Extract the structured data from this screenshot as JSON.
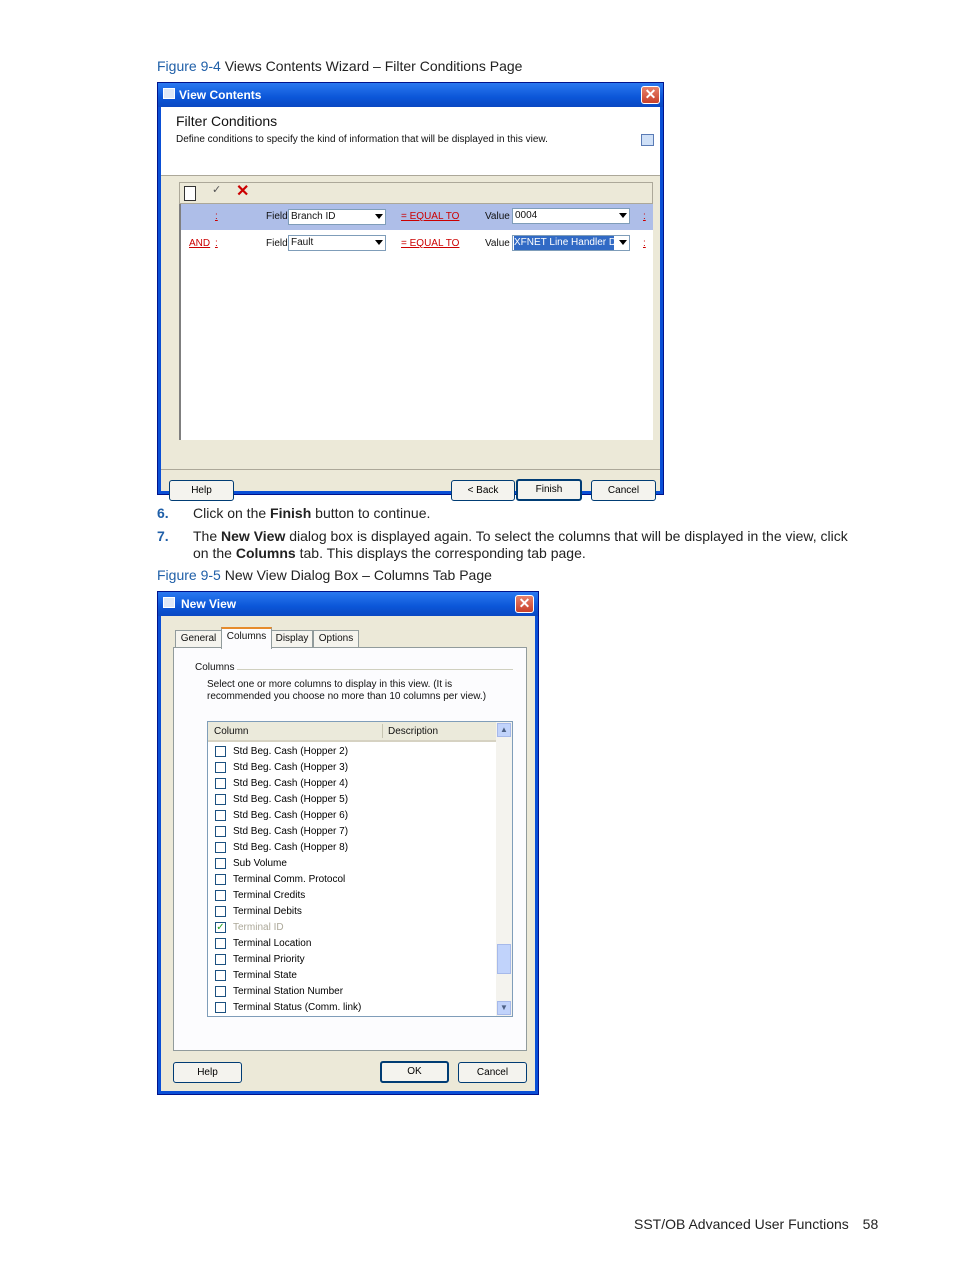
{
  "figure_9_4": {
    "label": "Figure 9-4",
    "caption": "Views Contents Wizard – Filter Conditions Page"
  },
  "view_contents": {
    "title": "View Contents",
    "heading": "Filter Conditions",
    "description": "Define conditions to specify the kind of information that will be displayed in this view.",
    "rows": [
      {
        "conj": "",
        "field_label": "Field",
        "field": "Branch ID",
        "op": "= EQUAL TO",
        "value_label": "Value",
        "value": "0004"
      },
      {
        "conj": "AND",
        "field_label": "Field",
        "field": "Fault",
        "op": "= EQUAL TO",
        "value_label": "Value",
        "value": "XFNET Line Handler Di"
      }
    ],
    "buttons": {
      "help": "Help",
      "back": "< Back",
      "finish": "Finish",
      "cancel": "Cancel"
    }
  },
  "steps": [
    {
      "num": "6.",
      "pre": "Click on the ",
      "b1": "Finish",
      "post": " button to continue."
    },
    {
      "num": "7.",
      "pre": "The ",
      "b1": "New View",
      "mid": " dialog box is displayed again.  To select the columns that will be displayed in the view, click on the ",
      "b2": "Columns",
      "post": " tab.  This displays the corresponding tab page."
    }
  ],
  "figure_9_5": {
    "label": "Figure 9-5",
    "caption": "New View Dialog Box – Columns Tab Page"
  },
  "new_view": {
    "title": "New View",
    "tabs": [
      "General",
      "Columns",
      "Display",
      "Options"
    ],
    "group_label": "Columns",
    "instructions": "Select one or more columns to display in this view. (It is recommended you choose no more than 10 columns per view.)",
    "col_headers": [
      "Column",
      "Description"
    ],
    "items": [
      {
        "label": "Std Beg. Cash  (Hopper 2)",
        "checked": false
      },
      {
        "label": "Std Beg. Cash  (Hopper 3)",
        "checked": false
      },
      {
        "label": "Std Beg. Cash  (Hopper 4)",
        "checked": false
      },
      {
        "label": "Std Beg. Cash  (Hopper 5)",
        "checked": false
      },
      {
        "label": "Std Beg. Cash  (Hopper 6)",
        "checked": false
      },
      {
        "label": "Std Beg. Cash  (Hopper 7)",
        "checked": false
      },
      {
        "label": "Std Beg. Cash  (Hopper 8)",
        "checked": false
      },
      {
        "label": "Sub Volume",
        "checked": false
      },
      {
        "label": "Terminal Comm. Protocol",
        "checked": false
      },
      {
        "label": "Terminal Credits",
        "checked": false
      },
      {
        "label": "Terminal Debits",
        "checked": false
      },
      {
        "label": "Terminal ID",
        "checked": true,
        "disabled": true
      },
      {
        "label": "Terminal Location",
        "checked": false
      },
      {
        "label": "Terminal Priority",
        "checked": false
      },
      {
        "label": "Terminal State",
        "checked": false
      },
      {
        "label": "Terminal Station Number",
        "checked": false
      },
      {
        "label": "Terminal Status (Comm. link)",
        "checked": false
      }
    ],
    "buttons": {
      "help": "Help",
      "ok": "OK",
      "cancel": "Cancel"
    }
  },
  "footer": {
    "text": "SST/OB Advanced User Functions",
    "page": "58"
  }
}
